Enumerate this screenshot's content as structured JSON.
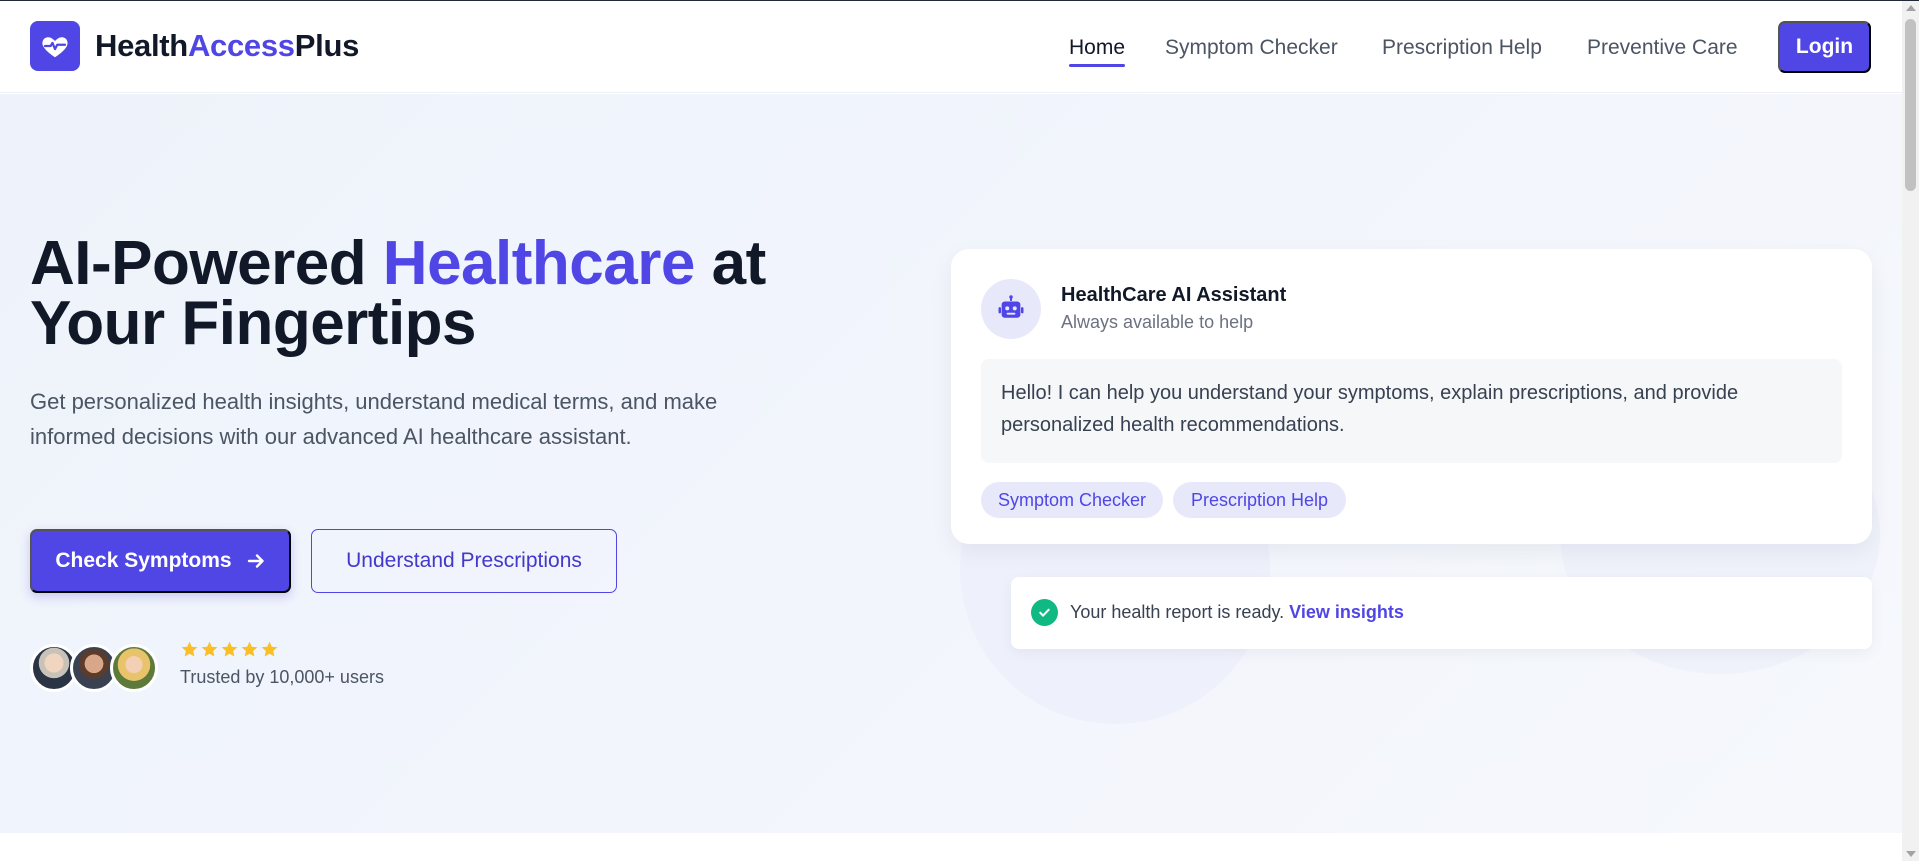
{
  "brand": {
    "part1": "Health",
    "part2": "Access",
    "part3": "Plus",
    "logo_icon": "heart-pulse-icon",
    "accent": "#4f46e5"
  },
  "nav": {
    "items": [
      {
        "label": "Home",
        "active": true
      },
      {
        "label": "Symptom Checker",
        "active": false
      },
      {
        "label": "Prescription Help",
        "active": false
      },
      {
        "label": "Preventive Care",
        "active": false
      }
    ],
    "login_label": "Login"
  },
  "hero": {
    "title_part1": "AI-Powered ",
    "title_highlight": "Healthcare",
    "title_part2": " at Your Fingertips",
    "subtitle": "Get personalized health insights, understand medical terms, and make informed decisions with our advanced AI healthcare assistant.",
    "primary_button": "Check Symptoms",
    "primary_button_icon": "arrow-right-icon",
    "secondary_button": "Understand Prescriptions",
    "rating": {
      "stars": 5,
      "max": 5,
      "star_color": "#fbbf24"
    },
    "trusted_text": "Trusted by 10,000+ users"
  },
  "assistant_card": {
    "icon": "robot-icon",
    "title": "HealthCare AI Assistant",
    "subtitle": "Always available to help",
    "message": "Hello! I can help you understand your symptoms, explain prescriptions, and provide personalized health recommendations.",
    "chips": [
      "Symptom Checker",
      "Prescription Help"
    ]
  },
  "notice": {
    "icon": "check-circle-icon",
    "text": "Your health report is ready. ",
    "link": "View insights",
    "success_color": "#10b981"
  }
}
